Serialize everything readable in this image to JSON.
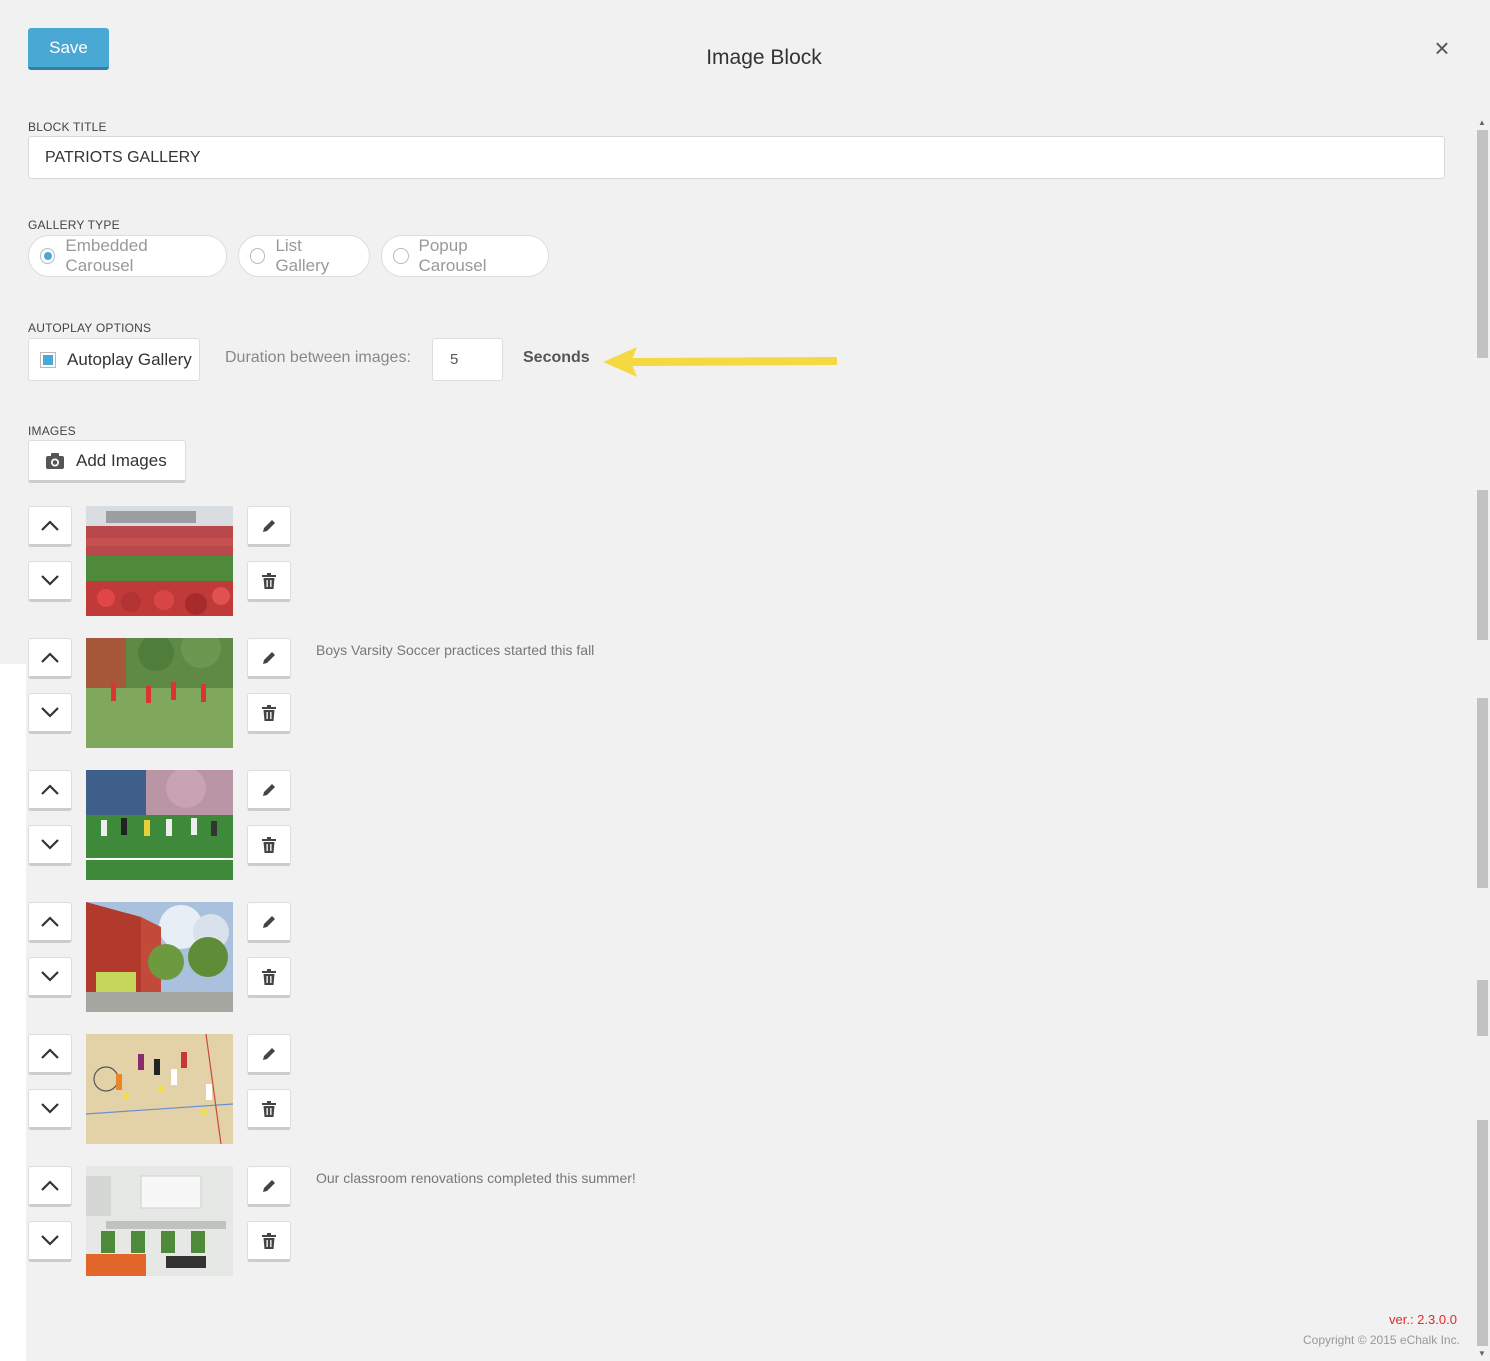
{
  "header": {
    "save_label": "Save",
    "title": "Image Block",
    "close_glyph": "×"
  },
  "block_title": {
    "label": "BLOCK TITLE",
    "value": "PATRIOTS GALLERY"
  },
  "gallery_type": {
    "label": "GALLERY TYPE",
    "options": [
      "Embedded Carousel",
      "List Gallery",
      "Popup Carousel"
    ],
    "selected": "Embedded Carousel"
  },
  "autoplay": {
    "label": "AUTOPLAY OPTIONS",
    "checkbox_label": "Autoplay Gallery",
    "checked": true,
    "duration_label": "Duration between images:",
    "duration_value": "5",
    "unit": "Seconds",
    "highlight_arrow_color": "#f5d942"
  },
  "images": {
    "label": "IMAGES",
    "add_label": "Add Images",
    "items": [
      {
        "thumb": "stadium-crowd",
        "caption": ""
      },
      {
        "thumb": "soccer-practice",
        "caption": "Boys Varsity Soccer practices started this fall"
      },
      {
        "thumb": "field-team",
        "caption": ""
      },
      {
        "thumb": "school-building",
        "caption": ""
      },
      {
        "thumb": "gym-class",
        "caption": ""
      },
      {
        "thumb": "classroom",
        "caption": "Our classroom renovations completed this summer!"
      }
    ]
  },
  "footer": {
    "version": "ver.: 2.3.0.0",
    "copyright": "Copyright © 2015 eChalk Inc."
  },
  "colors": {
    "accent": "#4aa8d4",
    "version_red": "#e02a2a"
  }
}
